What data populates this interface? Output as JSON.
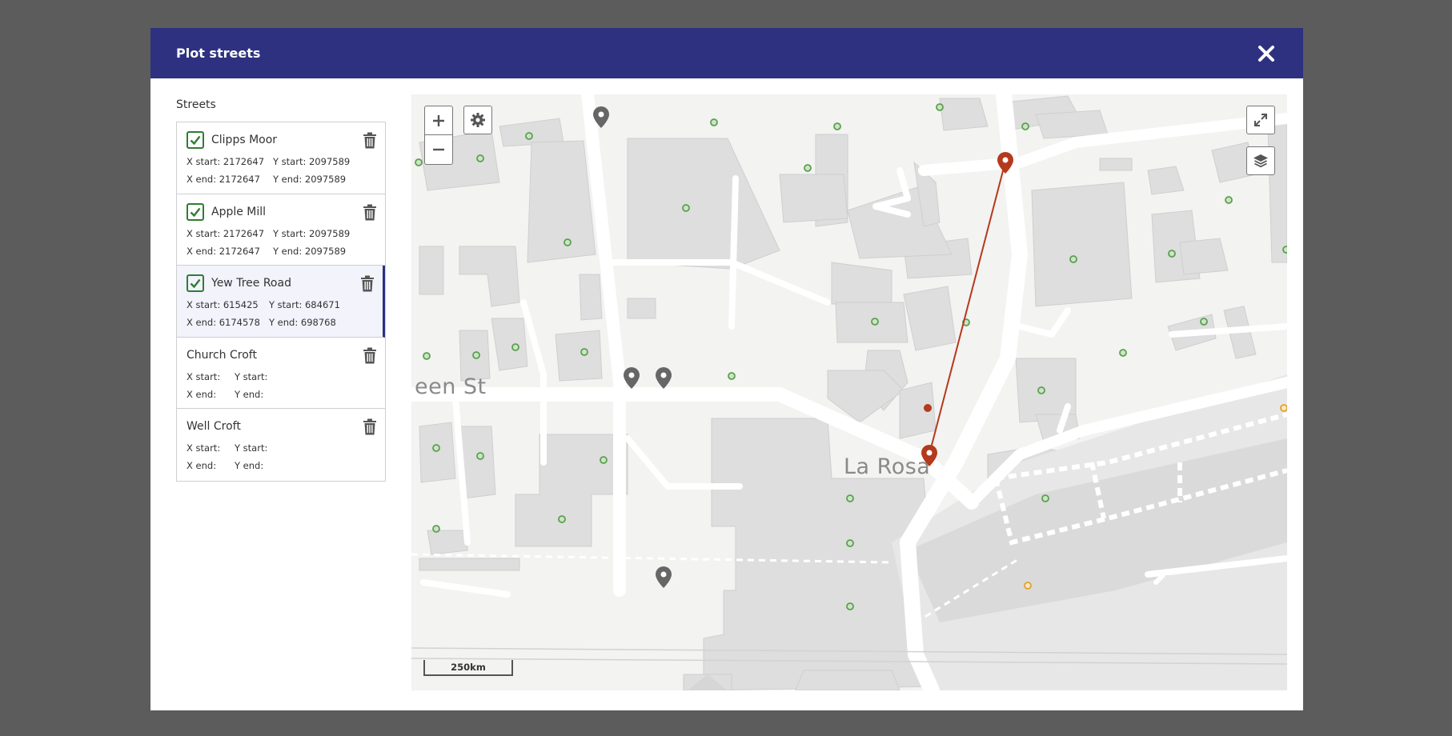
{
  "modal": {
    "title": "Plot streets"
  },
  "sidebar": {
    "heading": "Streets",
    "streets": [
      {
        "name": "Clipps Moor",
        "checked": true,
        "x_start": "X start: 2172647",
        "y_start": "Y start: 2097589",
        "x_end": "X end: 2172647",
        "y_end": "Y end: 2097589"
      },
      {
        "name": "Apple Mill",
        "checked": true,
        "x_start": "X start: 2172647",
        "y_start": "Y start: 2097589",
        "x_end": "X end: 2172647",
        "y_end": "Y end: 2097589"
      },
      {
        "name": "Yew Tree Road",
        "checked": true,
        "selected": true,
        "x_start": "X start: 615425",
        "y_start": "Y start: 684671",
        "x_end": "X end: 6174578",
        "y_end": "Y end: 698768"
      },
      {
        "name": "Church Croft",
        "checked": false,
        "x_start": "X start:",
        "y_start": "Y start:",
        "x_end": "X end:",
        "y_end": "Y end:"
      },
      {
        "name": "Well Croft",
        "checked": false,
        "x_start": "X start:",
        "y_start": "Y start:",
        "x_end": "X end:",
        "y_end": "Y end:"
      }
    ]
  },
  "map": {
    "labels": {
      "street": "een St",
      "place": "La Rosa"
    },
    "scale": "250km",
    "colors": {
      "route": "#b5391c",
      "marker": "#666666",
      "poi": "#5aa04f",
      "poi_alt": "#e0a030"
    }
  },
  "icons": {
    "close": "close-icon",
    "trash": "trash-icon",
    "check": "check-icon",
    "zoom_in": "plus-icon",
    "zoom_out": "minus-icon",
    "settings": "gear-icon",
    "fullscreen": "expand-icon",
    "layers": "layers-icon",
    "marker": "map-pin-icon"
  }
}
